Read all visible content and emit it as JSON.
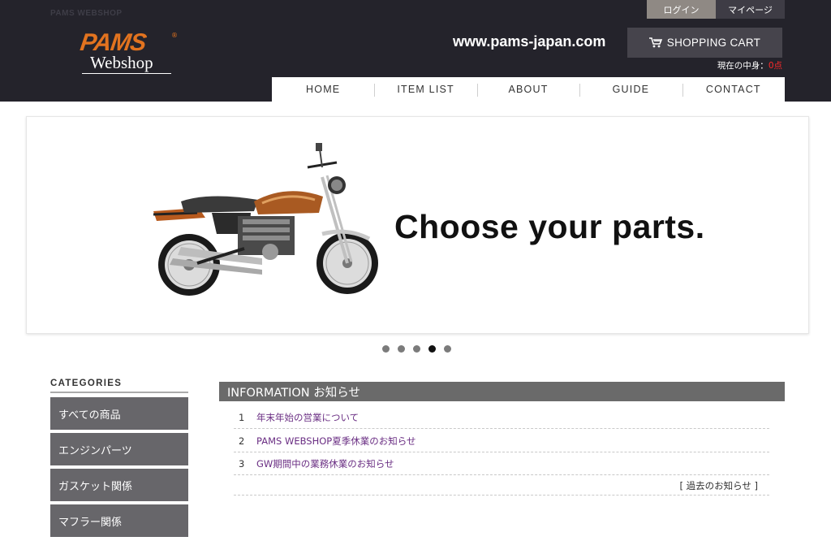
{
  "header": {
    "site_name_small": "PAMS WEBSHOP",
    "logo_brand": "PAMS",
    "logo_sub": "Webshop",
    "domain": "www.pams-japan.com",
    "login_label": "ログイン",
    "mypage_label": "マイページ",
    "cart_label": "SHOPPING CART",
    "cart_count_label": "現在の中身：",
    "cart_count_value": "0点"
  },
  "nav": [
    "HOME",
    "ITEM LIST",
    "ABOUT",
    "GUIDE",
    "CONTACT"
  ],
  "banner": {
    "headline": "Choose your parts.",
    "slides": 5,
    "active_slide": 4
  },
  "categories": {
    "heading": "CATEGORIES",
    "items": [
      "すべての商品",
      "エンジンパーツ",
      "ガスケット関係",
      "マフラー関係"
    ]
  },
  "information": {
    "heading": "INFORMATION お知らせ",
    "items": [
      {
        "num": "1",
        "title": "年末年始の営業について"
      },
      {
        "num": "2",
        "title": "PAMS WEBSHOP夏季休業のお知らせ"
      },
      {
        "num": "3",
        "title": "GW期間中の業務休業のお知らせ"
      }
    ],
    "past_link": "[ 過去のお知らせ ]"
  },
  "colors": {
    "header_bg": "#24232b",
    "brand_orange": "#e2731f",
    "link_purple": "#6a2e83",
    "sidebar_gray": "#67666a"
  }
}
